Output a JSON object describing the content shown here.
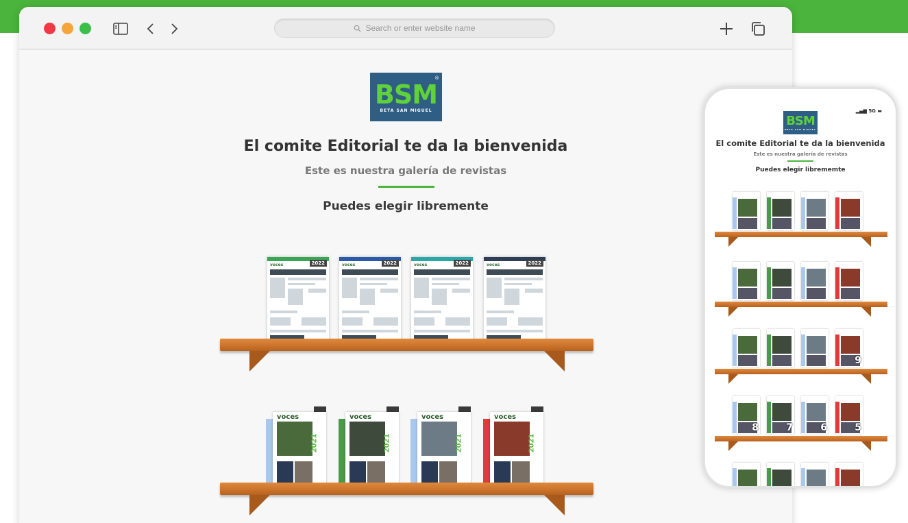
{
  "colors": {
    "accent_green": "#4bb43c",
    "logo_blue": "#2f5e84",
    "logo_green": "#5fd13a",
    "shelf_wood": "#c46f2a"
  },
  "browser": {
    "url_placeholder": "Search or enter website name",
    "icons": [
      "sidebar-icon",
      "back-chevron-icon",
      "forward-chevron-icon",
      "search-icon",
      "plus-icon",
      "tabs-overview-icon"
    ]
  },
  "logo": {
    "letters": "BSM",
    "subtitle": "BETA SAN MIGUEL",
    "registered": "®"
  },
  "page": {
    "title": "El comite Editorial te da la bienvenida",
    "subtitle": "Este es nuestra galería de revistas",
    "cta": "Puedes elegir libremente"
  },
  "shelf_top": {
    "magazines": [
      {
        "year": "2022",
        "brand": "voces",
        "header_color": "#3aa655"
      },
      {
        "year": "2022",
        "brand": "voces",
        "header_color": "#2b5aa8"
      },
      {
        "year": "2022",
        "brand": "voces",
        "header_color": "#2aa8a8"
      },
      {
        "year": "2022",
        "brand": "voces",
        "header_color": "#2d3f55"
      }
    ]
  },
  "shelf_bottom": {
    "magazines": [
      {
        "year": "2021",
        "brand": "voces",
        "side_color": "#a8c8ee"
      },
      {
        "year": "2021",
        "brand": "voces",
        "side_color": "#4a9a4a"
      },
      {
        "year": "2021",
        "brand": "voces",
        "side_color": "#a8c8ee"
      },
      {
        "year": "2021",
        "brand": "voces",
        "side_color": "#e03a3a"
      }
    ]
  },
  "phone": {
    "status": "5G",
    "title": "El comite Editorial te da la bienvenida",
    "subtitle": "Este es nuestra galería de revistas",
    "cta": "Puedes elegir librememte",
    "shelves": [
      {
        "items": [
          "",
          "",
          "",
          ""
        ]
      },
      {
        "items": [
          "",
          "",
          "",
          ""
        ]
      },
      {
        "items": [
          "",
          "",
          "",
          "9"
        ]
      },
      {
        "items": [
          "8",
          "7",
          "6",
          "5"
        ]
      },
      {
        "items": [
          "",
          "",
          "",
          ""
        ]
      }
    ]
  }
}
